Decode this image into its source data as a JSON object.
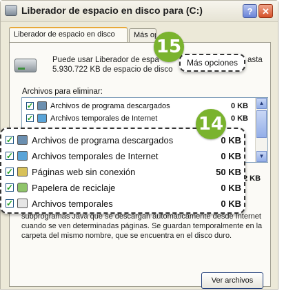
{
  "window": {
    "title": "Liberador de espacio en disco para  (C:)",
    "help_label": "?",
    "close_label": "✕"
  },
  "tabs": [
    {
      "label": "Liberador de espacio en disco",
      "active": true
    },
    {
      "label": "Más opciones",
      "active": false
    }
  ],
  "info": {
    "text_line1": "Puede usar Liberador de espa",
    "text_line1_tail": "asta",
    "text_line2": "5.930.722 KB de espacio de disco"
  },
  "list_label": "Archivos para eliminar:",
  "list_items": [
    {
      "label": "Archivos de programa descargados",
      "size": "0 KB",
      "checked": true,
      "icon": "folder-download-icon"
    },
    {
      "label": "Archivos temporales de Internet",
      "size": "0 KB",
      "checked": true,
      "icon": "internet-temp-icon"
    },
    {
      "label": "Páginas web sin conexión",
      "size": "50 KB",
      "checked": true,
      "icon": "web-page-icon"
    },
    {
      "label": "Papelera de reciclaje",
      "size": "0 KB",
      "checked": true,
      "icon": "recycle-bin-icon"
    },
    {
      "label": "Archivos temporales",
      "size": "0 KB",
      "checked": true,
      "icon": "temp-file-icon"
    }
  ],
  "partial_size": "2 KB",
  "description": "subprogramas Java que se descargan automáticamente desde Internet cuando se ven determinadas páginas. Se guardan temporalmente en la carpeta del mismo nombre, que se encuentra en el disco duro.",
  "view_files_label": "Ver archivos",
  "callouts": {
    "more_options": "Más opciones",
    "badge_15": "15",
    "badge_14": "14",
    "badge_color": "#7ab32e"
  }
}
